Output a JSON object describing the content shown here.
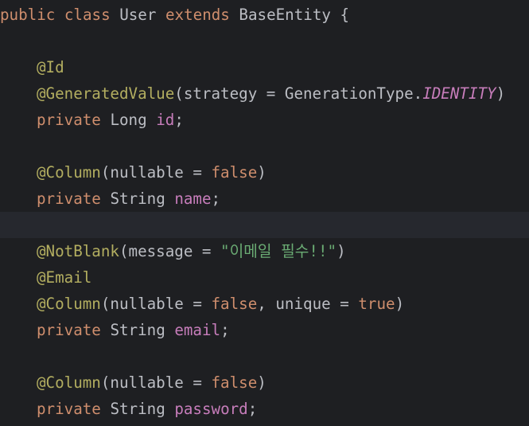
{
  "editor": {
    "class_decl": {
      "kw_public": "public",
      "kw_class": "class",
      "class_name": "User",
      "kw_extends": "extends",
      "parent": "BaseEntity",
      "brace": "{"
    },
    "id_field": {
      "ann_id": "@Id",
      "ann_generated": "@GeneratedValue",
      "gen_args_open": "(strategy = GenerationType.",
      "gen_const": "IDENTITY",
      "gen_args_close": ")",
      "kw_private": "private",
      "type": "Long",
      "name": "id",
      "semi": ";"
    },
    "name_field": {
      "ann_column": "@Column",
      "args_open": "(nullable = ",
      "val_false": "false",
      "args_close": ")",
      "kw_private": "private",
      "type": "String",
      "name": "name",
      "semi": ";"
    },
    "email_field": {
      "ann_notblank": "@NotBlank",
      "nb_open": "(message = ",
      "nb_string": "\"이메일 필수!!\"",
      "nb_close": ")",
      "ann_email": "@Email",
      "ann_column": "@Column",
      "col_open": "(nullable = ",
      "val_false": "false",
      "col_mid": ", unique = ",
      "val_true": "true",
      "col_close": ")",
      "kw_private": "private",
      "type": "String",
      "name": "email",
      "semi": ";"
    },
    "password_field": {
      "ann_column": "@Column",
      "args_open": "(nullable = ",
      "val_false": "false",
      "args_close": ")",
      "kw_private": "private",
      "type": "String",
      "name": "password",
      "semi": ";"
    }
  }
}
